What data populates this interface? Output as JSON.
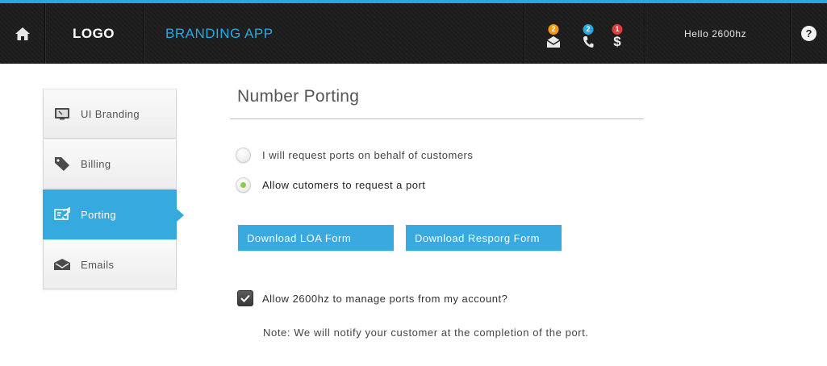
{
  "topbar": {
    "logo": "LOGO",
    "app_name": "BRANDING APP",
    "greeting": "Hello 2600hz",
    "help_label": "?",
    "notifications": [
      {
        "icon": "envelope-icon",
        "count": "2",
        "color": "#f39c12"
      },
      {
        "icon": "phone-icon",
        "count": "2",
        "color": "#29a8e0"
      },
      {
        "icon": "dollar-icon",
        "count": "1",
        "color": "#e23b3b"
      }
    ],
    "accent_color": "#29a8e0"
  },
  "sidebar": {
    "items": [
      {
        "label": "UI Branding",
        "icon": "monitor-icon",
        "active": false
      },
      {
        "label": "Billing",
        "icon": "tag-icon",
        "active": false
      },
      {
        "label": "Porting",
        "icon": "porting-icon",
        "active": true
      },
      {
        "label": "Emails",
        "icon": "envelope-icon",
        "active": false
      }
    ]
  },
  "main": {
    "title": "Number Porting",
    "options": [
      {
        "label": "I will request ports on behalf of customers",
        "selected": false
      },
      {
        "label": "Allow cutomers to request a port",
        "selected": true
      }
    ],
    "buttons": {
      "loa": "Download LOA Form",
      "resporg": "Download Resporg Form"
    },
    "manage_checkbox": {
      "label": "Allow 2600hz to manage ports from my account?",
      "checked": true
    },
    "note": "Note: We will notify your customer at the completion of the port."
  }
}
